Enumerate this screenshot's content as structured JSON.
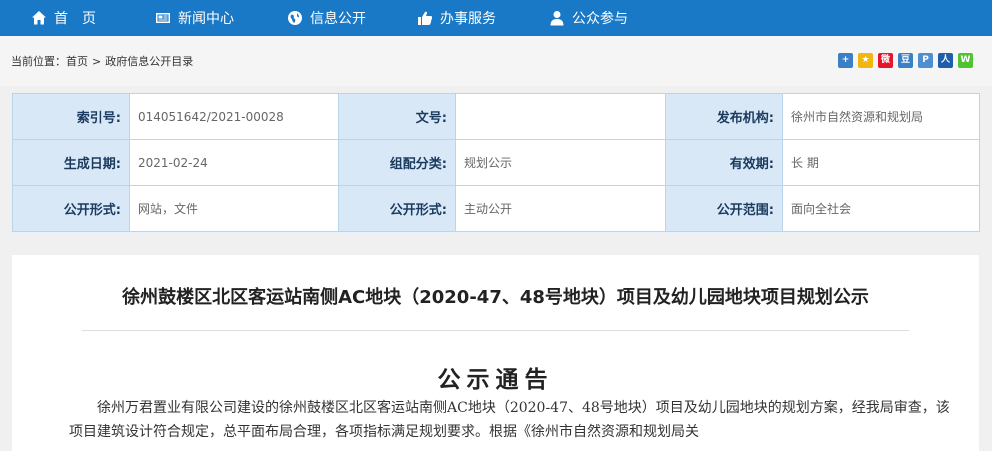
{
  "nav": {
    "items": [
      {
        "label": "首　页",
        "icon": "home-icon"
      },
      {
        "label": "新闻中心",
        "icon": "news-icon"
      },
      {
        "label": "信息公开",
        "icon": "globe-icon"
      },
      {
        "label": "办事服务",
        "icon": "thumbs-up-icon"
      },
      {
        "label": "公众参与",
        "icon": "user-icon"
      }
    ]
  },
  "breadcrumb": {
    "prefix": "当前位置：",
    "home": "首页",
    "separator": ">",
    "current": "政府信息公开目录"
  },
  "share": {
    "icons": [
      {
        "name": "share-plus-icon",
        "glyph": "+",
        "color": "#3b7fc4"
      },
      {
        "name": "share-qzone-icon",
        "glyph": "★",
        "color": "#f2b60f"
      },
      {
        "name": "share-weibo-icon",
        "glyph": "微",
        "color": "#e6162d"
      },
      {
        "name": "share-douban-icon",
        "glyph": "豆",
        "color": "#3b7fc4"
      },
      {
        "name": "share-pengyou-icon",
        "glyph": "P",
        "color": "#4f8fd0"
      },
      {
        "name": "share-renren-icon",
        "glyph": "人",
        "color": "#1f5fa9"
      },
      {
        "name": "share-wechat-icon",
        "glyph": "W",
        "color": "#51c332"
      }
    ]
  },
  "info": {
    "rows": [
      [
        {
          "label": "索引号:",
          "value": "014051642/2021-00028"
        },
        {
          "label": "文号:",
          "value": ""
        },
        {
          "label": "发布机构:",
          "value": "徐州市自然资源和规划局"
        }
      ],
      [
        {
          "label": "生成日期:",
          "value": "2021-02-24"
        },
        {
          "label": "组配分类:",
          "value": "规划公示"
        },
        {
          "label": "有效期:",
          "value": "长 期"
        }
      ],
      [
        {
          "label": "公开形式:",
          "value": "网站，文件"
        },
        {
          "label": "公开形式:",
          "value": "主动公开"
        },
        {
          "label": "公开范围:",
          "value": "面向全社会"
        }
      ]
    ]
  },
  "article": {
    "title": "徐州鼓楼区北区客运站南侧AC地块（2020-47、48号地块）项目及幼儿园地块项目规划公示",
    "notice_heading": "公示通告",
    "paragraph": "徐州万君置业有限公司建设的徐州鼓楼区北区客运站南侧AC地块（2020-47、48号地块）项目及幼儿园地块的规划方案，经我局审查，该项目建筑设计符合规定，总平面布局合理，各项指标满足规划要求。根据《徐州市自然资源和规划局关"
  }
}
